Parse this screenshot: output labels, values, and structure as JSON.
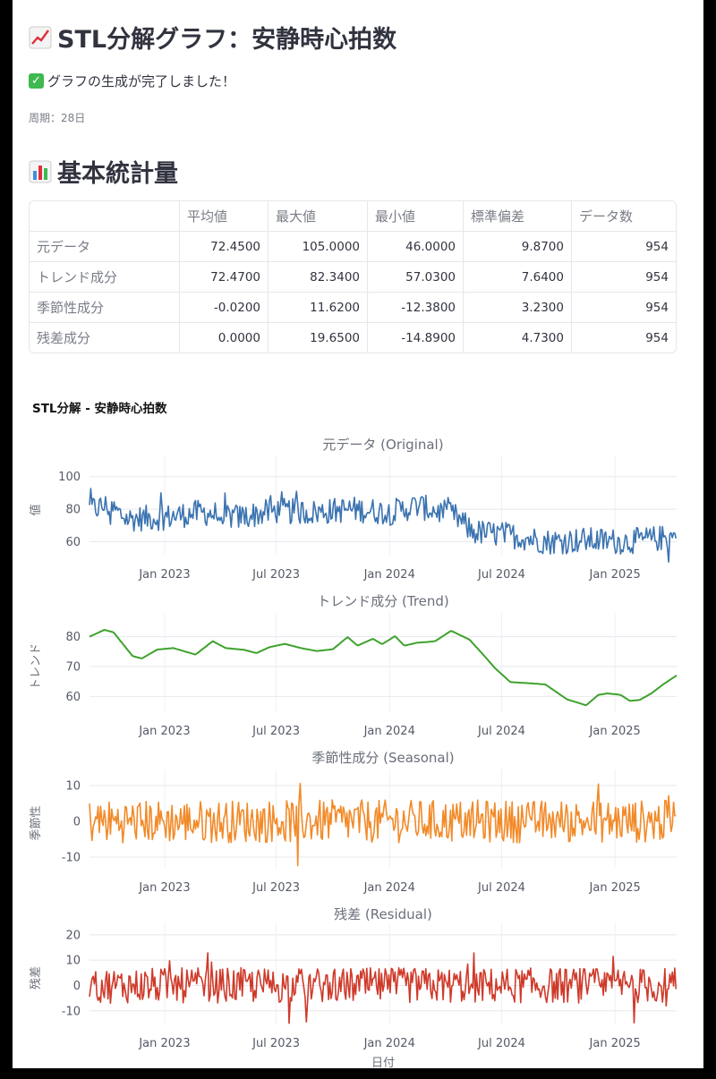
{
  "header": {
    "title": "STL分解グラフ：安静時心拍数",
    "title_icon": "chart-increasing-icon"
  },
  "status": {
    "message": "グラフの生成が完了しました！",
    "icon": "check-mark-icon"
  },
  "period": "周期：28日",
  "stats": {
    "title": "基本統計量",
    "title_icon": "bar-chart-icon",
    "columns": [
      "",
      "平均値",
      "最大値",
      "最小値",
      "標準偏差",
      "データ数"
    ],
    "rows": [
      {
        "label": "元データ",
        "values": [
          "72.4500",
          "105.0000",
          "46.0000",
          "9.8700",
          "954"
        ]
      },
      {
        "label": "トレンド成分",
        "values": [
          "72.4700",
          "82.3400",
          "57.0300",
          "7.6400",
          "954"
        ]
      },
      {
        "label": "季節性成分",
        "values": [
          "-0.0200",
          "11.6200",
          "-12.3800",
          "3.2300",
          "954"
        ]
      },
      {
        "label": "残差成分",
        "values": [
          "0.0000",
          "19.6500",
          "-14.8900",
          "4.7300",
          "954"
        ]
      }
    ]
  },
  "chart_data": {
    "type": "line",
    "title": "STL分解 - 安静時心拍数",
    "xlabel": "日付",
    "x_range": [
      "2022-09-01",
      "2025-04-11"
    ],
    "x_ticks": [
      "Jan 2023",
      "Jul 2023",
      "Jan 2024",
      "Jul 2024",
      "Jan 2025"
    ],
    "grid": true,
    "panels": [
      {
        "name": "元データ (Original)",
        "ylabel": "値",
        "color": "#3b73b0",
        "ylim": [
          52,
          107
        ],
        "yticks": [
          60,
          80,
          100
        ],
        "style": "noisy",
        "trend_points": [
          [
            "2022-09-01",
            80
          ],
          [
            "2022-10-01",
            82
          ],
          [
            "2022-11-01",
            74
          ],
          [
            "2023-01-01",
            75
          ],
          [
            "2023-03-01",
            78
          ],
          [
            "2023-05-01",
            75
          ],
          [
            "2023-07-01",
            79
          ],
          [
            "2023-09-01",
            78
          ],
          [
            "2023-11-01",
            80
          ],
          [
            "2024-01-01",
            78
          ],
          [
            "2024-02-15",
            82
          ],
          [
            "2024-04-15",
            76
          ],
          [
            "2024-05-15",
            66
          ],
          [
            "2024-07-15",
            64
          ],
          [
            "2024-09-15",
            60
          ],
          [
            "2024-11-15",
            61
          ],
          [
            "2025-01-15",
            60
          ],
          [
            "2025-04-11",
            63
          ]
        ],
        "noise_amplitude": 8,
        "series_range": {
          "min": 46,
          "max": 105
        }
      },
      {
        "name": "トレンド成分 (Trend)",
        "ylabel": "トレンド",
        "color": "#3ea22c",
        "ylim": [
          55,
          85
        ],
        "yticks": [
          60,
          70,
          80
        ],
        "style": "smooth",
        "points": [
          [
            "2022-09-01",
            80
          ],
          [
            "2022-09-25",
            82.3
          ],
          [
            "2022-10-10",
            81.5
          ],
          [
            "2022-11-10",
            73.5
          ],
          [
            "2022-11-25",
            72.7
          ],
          [
            "2022-12-20",
            75.7
          ],
          [
            "2023-01-15",
            76.2
          ],
          [
            "2023-02-20",
            74.0
          ],
          [
            "2023-03-20",
            78.5
          ],
          [
            "2023-04-10",
            76.2
          ],
          [
            "2023-05-10",
            75.6
          ],
          [
            "2023-05-30",
            74.5
          ],
          [
            "2023-06-20",
            76.5
          ],
          [
            "2023-07-15",
            77.6
          ],
          [
            "2023-08-10",
            76.2
          ],
          [
            "2023-09-05",
            75.2
          ],
          [
            "2023-10-01",
            75.8
          ],
          [
            "2023-10-25",
            79.9
          ],
          [
            "2023-11-10",
            77.0
          ],
          [
            "2023-12-05",
            79.3
          ],
          [
            "2023-12-20",
            77.5
          ],
          [
            "2024-01-10",
            80.2
          ],
          [
            "2024-01-25",
            77.0
          ],
          [
            "2024-02-15",
            78.0
          ],
          [
            "2024-03-01",
            78.2
          ],
          [
            "2024-03-15",
            78.5
          ],
          [
            "2024-04-10",
            82.0
          ],
          [
            "2024-05-10",
            79.0
          ],
          [
            "2024-06-01",
            74.0
          ],
          [
            "2024-06-20",
            69.5
          ],
          [
            "2024-07-15",
            64.8
          ],
          [
            "2024-08-15",
            64.4
          ],
          [
            "2024-09-10",
            64.0
          ],
          [
            "2024-10-15",
            59.0
          ],
          [
            "2024-11-15",
            57.0
          ],
          [
            "2024-12-05",
            60.5
          ],
          [
            "2024-12-20",
            61.0
          ],
          [
            "2025-01-10",
            60.5
          ],
          [
            "2025-01-25",
            58.5
          ],
          [
            "2025-02-10",
            58.8
          ],
          [
            "2025-03-01",
            61.0
          ],
          [
            "2025-03-20",
            64.0
          ],
          [
            "2025-04-11",
            67.0
          ]
        ]
      },
      {
        "name": "季節性成分 (Seasonal)",
        "ylabel": "季節性",
        "color": "#f28a28",
        "ylim": [
          -13,
          12
        ],
        "yticks": [
          -10,
          0,
          10
        ],
        "style": "noise",
        "noise_amplitude": 6,
        "series_range": {
          "min": -12.38,
          "max": 11.62
        }
      },
      {
        "name": "残差 (Residual)",
        "ylabel": "残差",
        "color": "#cf3a2a",
        "ylim": [
          -15,
          21
        ],
        "yticks": [
          -10,
          0,
          10,
          20
        ],
        "style": "noise",
        "noise_amplitude": 7,
        "series_range": {
          "min": -14.89,
          "max": 19.65
        }
      }
    ]
  }
}
